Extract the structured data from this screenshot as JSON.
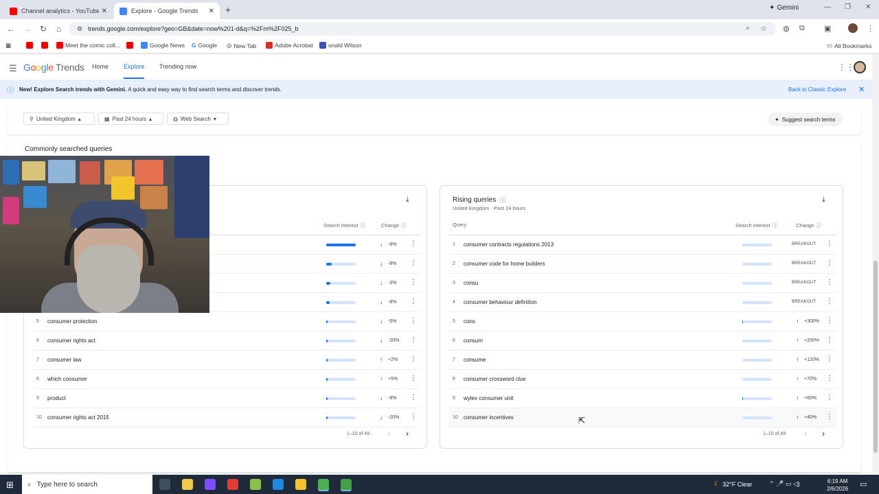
{
  "browser": {
    "tabs": [
      {
        "title": "Channel analytics - YouTube Stu",
        "icon_color": "#ff0000"
      },
      {
        "title": "Explore - Google Trends",
        "icon_color": "#4285f4"
      }
    ],
    "gemini_label": "Gemini",
    "url": "trends.google.com/explore?geo=GB&date=now%201-d&q=%2Fm%2F025_b",
    "bookmarks": [
      "Meet the comic coll...",
      "Google News",
      "Google",
      "New Tab",
      "Adobe Acrobat",
      "onald Wilson"
    ],
    "all_bookmarks": "All Bookmarks"
  },
  "header": {
    "logo_google": "Google",
    "logo_trends": "Trends",
    "nav": [
      "Home",
      "Explore",
      "Trending now"
    ]
  },
  "banner": {
    "bold": "New! Explore Search trends with Gemini.",
    "text": "A quick and easy way to find search terms and discover trends.",
    "link": "Back to Classic Explore"
  },
  "filters": {
    "region": "United Kingdom",
    "time": "Past 24 hours",
    "type": "Web Search",
    "suggest": "Suggest search terms"
  },
  "section_title": "Commonly searched queries",
  "left_card": {
    "headers": {
      "interest": "Search interest",
      "change": "Change"
    },
    "rows": [
      {
        "num": "5",
        "query": "consumer protection",
        "interest": 0.05,
        "dir": "↓",
        "change": "-5%"
      },
      {
        "num": "6",
        "query": "consumer rights act",
        "interest": 0.05,
        "dir": "↓",
        "change": "-20%"
      },
      {
        "num": "7",
        "query": "consumer law",
        "interest": 0.05,
        "dir": "↑",
        "change": "+2%"
      },
      {
        "num": "8",
        "query": "which consumer",
        "interest": 0.05,
        "dir": "↑",
        "change": "+5%"
      },
      {
        "num": "9",
        "query": "product",
        "interest": 0.05,
        "dir": "↓",
        "change": "-8%"
      },
      {
        "num": "10",
        "query": "consumer rights act 2015",
        "interest": 0.05,
        "dir": "↓",
        "change": "-20%"
      }
    ],
    "hidden_rows": [
      {
        "interest": 1.0,
        "dir": "↓",
        "change": "-6%"
      },
      {
        "interest": 0.18,
        "dir": "↓",
        "change": "-8%"
      },
      {
        "interest": 0.14,
        "dir": "↓",
        "change": "-3%"
      },
      {
        "interest": 0.11,
        "dir": "↓",
        "change": "-8%"
      }
    ],
    "pager": "1–10 of 49"
  },
  "right_card": {
    "title": "Rising queries",
    "subtitle": "United Kingdom · Past 24 hours",
    "headers": {
      "query": "Query",
      "interest": "Search interest",
      "change": "Change"
    },
    "rows": [
      {
        "num": "1",
        "query": "consumer contracts regulations 2013",
        "interest": 0.0,
        "dir": "",
        "change": "BREAKOUT"
      },
      {
        "num": "2",
        "query": "consumer code for home builders",
        "interest": 0.0,
        "dir": "",
        "change": "BREAKOUT"
      },
      {
        "num": "3",
        "query": "consu",
        "interest": 0.0,
        "dir": "",
        "change": "BREAKOUT"
      },
      {
        "num": "4",
        "query": "consumer behaviour definition",
        "interest": 0.0,
        "dir": "",
        "change": "BREAKOUT"
      },
      {
        "num": "5",
        "query": "cons",
        "interest": 0.03,
        "dir": "↑",
        "change": "+300%"
      },
      {
        "num": "6",
        "query": "consum",
        "interest": 0.0,
        "dir": "↑",
        "change": "+200%"
      },
      {
        "num": "7",
        "query": "consume",
        "interest": 0.0,
        "dir": "↑",
        "change": "+120%"
      },
      {
        "num": "8",
        "query": "consumer crossword clue",
        "interest": 0.0,
        "dir": "↑",
        "change": "+70%"
      },
      {
        "num": "9",
        "query": "wylex consumer unit",
        "interest": 0.03,
        "dir": "↑",
        "change": "+60%"
      },
      {
        "num": "10",
        "query": "consumer incentives",
        "interest": 0.0,
        "dir": "↑",
        "change": "+40%"
      }
    ],
    "pager": "1–10 of 49"
  },
  "taskbar": {
    "search_placeholder": "Type here to search",
    "weather": "32°F  Clear",
    "time": "6:19 AM",
    "date": "2/6/2026"
  }
}
